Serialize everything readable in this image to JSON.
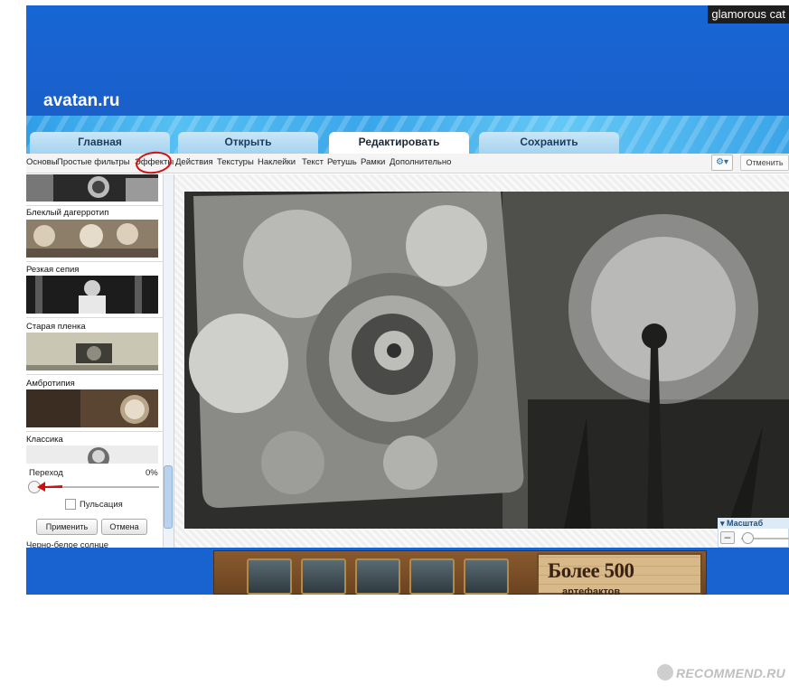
{
  "header": {
    "user": "glamorous cat",
    "logo": "avatan.ru"
  },
  "tabs": [
    "Главная",
    "Открыть",
    "Редактировать",
    "Сохранить"
  ],
  "menu": [
    "Основы",
    "Простые фильтры",
    "Эффекты",
    "Действия",
    "Текстуры",
    "Наклейки",
    "Текст",
    "Ретушь",
    "Рамки",
    "Дополнительно"
  ],
  "toolbar": {
    "gear_icon": "gear-icon",
    "cancel_label": "Отменить"
  },
  "effects": [
    {
      "label": "Блеклый дагерротип"
    },
    {
      "label": "Резкая сепия"
    },
    {
      "label": "Старая пленка"
    },
    {
      "label": "Амбротипия"
    },
    {
      "label": "Классика"
    }
  ],
  "settings": {
    "transition_label": "Переход",
    "transition_value": "0%",
    "pulsation_label": "Пульсация",
    "apply_label": "Применить",
    "cancel_label": "Отмена",
    "next_effect": "Черно-белое солнце"
  },
  "zoom": {
    "title": "Масштаб",
    "minus": "–"
  },
  "ad": {
    "headline": "Более 500",
    "sub": "артефактов"
  },
  "watermark": "RECOMMEND.RU",
  "colors": {
    "header_blue": "#1766d6",
    "accent_red": "#d01010"
  }
}
